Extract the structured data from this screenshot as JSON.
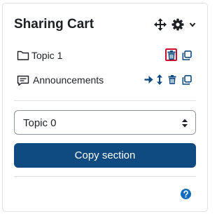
{
  "block": {
    "title": "Sharing Cart",
    "header_icons": [
      "move-icon",
      "gear-icon",
      "chevron-down-icon"
    ]
  },
  "items": [
    {
      "label": "Topic 1",
      "icon": "folder-icon",
      "actions": [
        "trash-icon",
        "copy-icon"
      ],
      "highlighted_action": "trash-icon"
    },
    {
      "label": "Announcements",
      "icon": "forum-icon",
      "actions": [
        "move-right-icon",
        "move-vertical-icon",
        "trash-icon",
        "copy-icon"
      ]
    }
  ],
  "section_select": {
    "selected": "Topic 0"
  },
  "copy_button": {
    "label": "Copy section"
  },
  "colors": {
    "accent": "#0f4a80",
    "highlight": "#c8102e",
    "icon_link": "#0f6cbf",
    "help": "#0f6cbf"
  }
}
